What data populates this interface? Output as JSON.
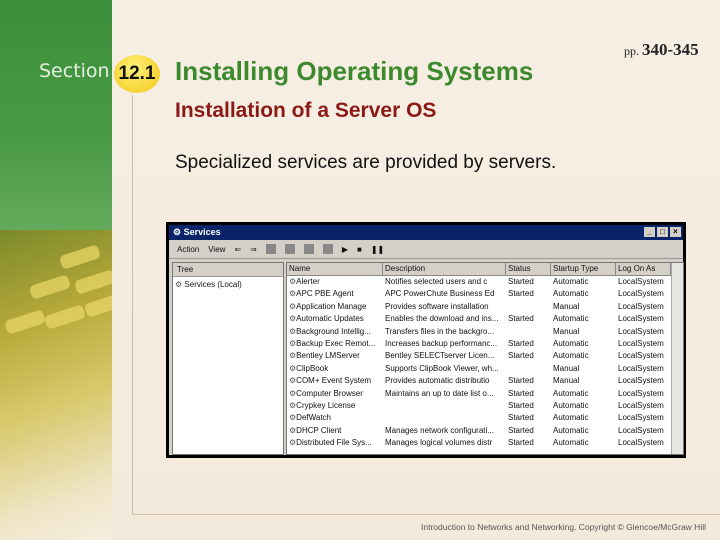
{
  "header": {
    "section_label": "Section",
    "section_number": "12.1",
    "title": "Installing Operating Systems",
    "pages": "pp.",
    "page_range": "340-345"
  },
  "subtitle": "Installation of a Server OS",
  "body_text": "Specialized services are provided by servers.",
  "window": {
    "title": "Services",
    "menu": [
      "Action",
      "View"
    ],
    "tree_header": "Tree",
    "tree_item": "Services (Local)",
    "columns": [
      "Name",
      "Description",
      "Status",
      "Startup Type",
      "Log On As"
    ],
    "rows": [
      [
        "Alerter",
        "Notifies selected users and c",
        "Started",
        "Automatic",
        "LocalSystem"
      ],
      [
        "APC PBE Agent",
        "APC PowerChute Business Ed",
        "Started",
        "Automatic",
        "LocalSystem"
      ],
      [
        "Application Manage",
        "Provides software installation",
        "",
        "Manual",
        "LocalSystem"
      ],
      [
        "Automatic Updates",
        "Enables the download and ins...",
        "Started",
        "Automatic",
        "LocalSystem"
      ],
      [
        "Background Intellig...",
        "Transfers files in the backgro...",
        "",
        "Manual",
        "LocalSystem"
      ],
      [
        "Backup Exec Remot...",
        "Increases backup performanc...",
        "Started",
        "Automatic",
        "LocalSystem"
      ],
      [
        "Bentley LMServer",
        "Bentley SELECTserver Licen...",
        "Started",
        "Automatic",
        "LocalSystem"
      ],
      [
        "ClipBook",
        "Supports ClipBook Viewer, wh...",
        "",
        "Manual",
        "LocalSystem"
      ],
      [
        "COM+ Event System",
        "Provides automatic distributio",
        "Started",
        "Manual",
        "LocalSystem"
      ],
      [
        "Computer Browser",
        "Maintains an up to date list o...",
        "Started",
        "Automatic",
        "LocalSystem"
      ],
      [
        "Crypkey License",
        "",
        "Started",
        "Automatic",
        "LocalSystem"
      ],
      [
        "DefWatch",
        "",
        "Started",
        "Automatic",
        "LocalSystem"
      ],
      [
        "DHCP Client",
        "Manages network configurati...",
        "Started",
        "Automatic",
        "LocalSystem"
      ],
      [
        "Distributed File Sys...",
        "Manages logical volumes distr",
        "Started",
        "Automatic",
        "LocalSystem"
      ]
    ]
  },
  "footer": "Introduction to Networks and Networking. Copyright © Glencoe/McGraw Hill"
}
